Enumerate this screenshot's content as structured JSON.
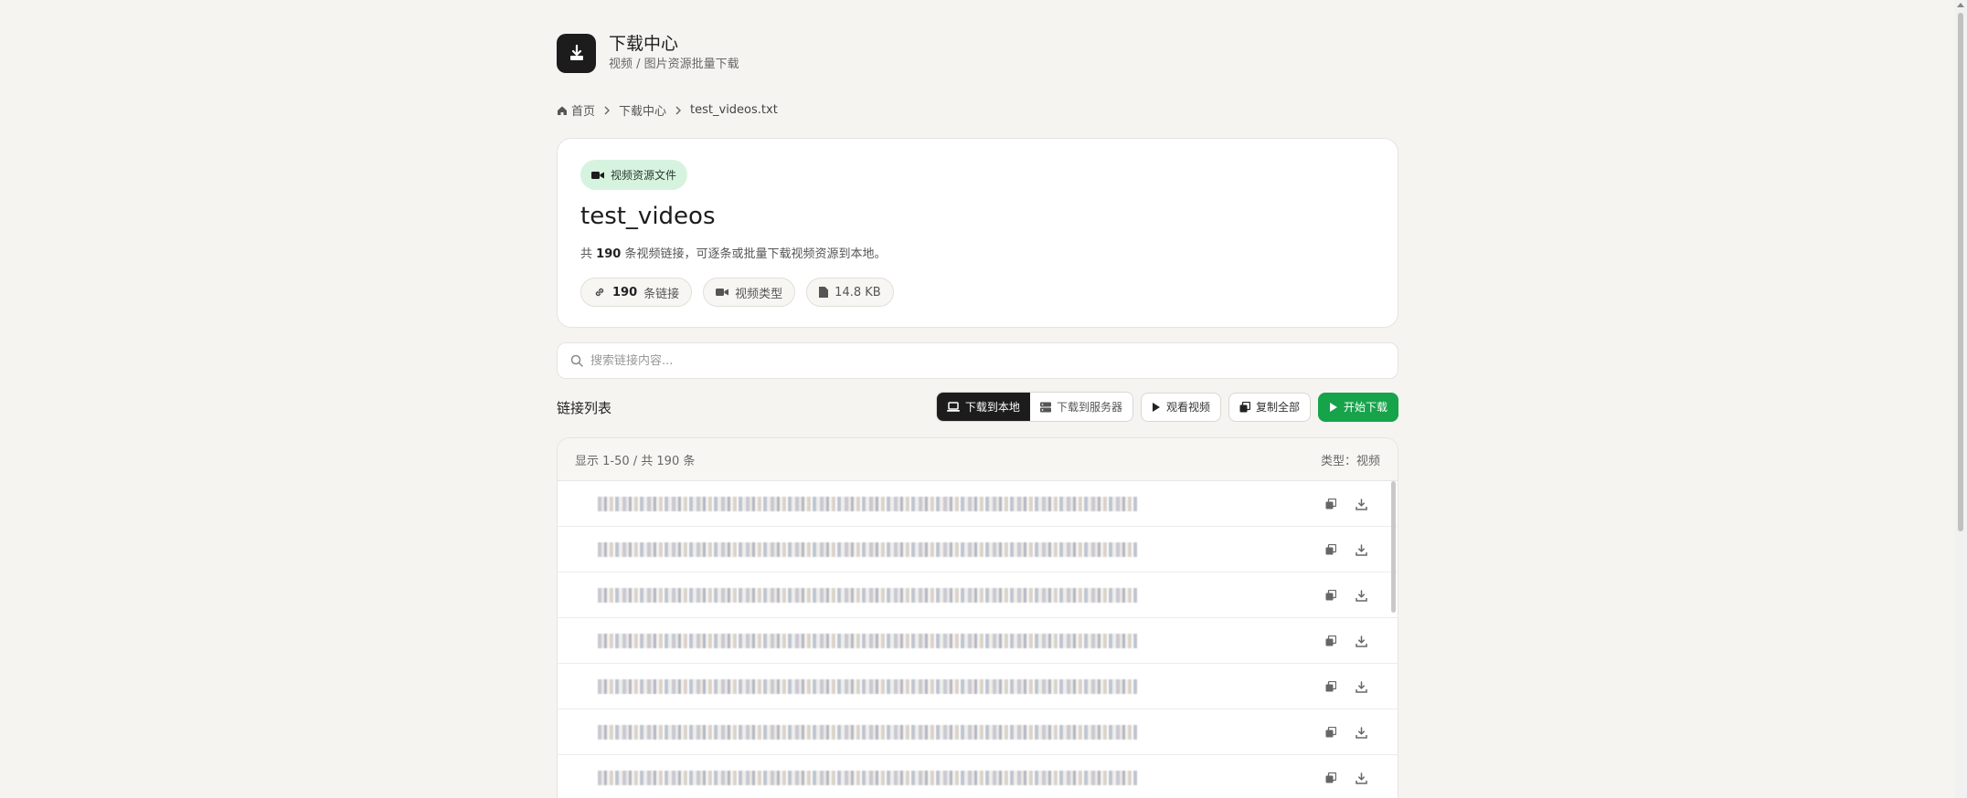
{
  "app": {
    "title": "下载中心",
    "subtitle": "视频 / 图片资源批量下载",
    "logo_icon": "download-icon"
  },
  "breadcrumb": {
    "home": "首页",
    "section": "下载中心",
    "current": "test_videos.txt"
  },
  "file": {
    "badge": "视频资源文件",
    "title": "test_videos",
    "desc_prefix": "共",
    "desc_count": "190",
    "desc_suffix": "条视频链接，可逐条或批量下载视频资源到本地。",
    "chips": {
      "links_count": "190",
      "links_label": "条链接",
      "type_label": "视频类型",
      "size": "14.8 KB"
    }
  },
  "search": {
    "placeholder": "搜索链接内容..."
  },
  "list": {
    "title": "链接列表",
    "range": "显示 1-50 / 共 190 条",
    "type": "类型：视频",
    "rows": [
      "",
      "",
      "",
      "",
      "",
      "",
      ""
    ]
  },
  "toolbar": {
    "download_local": "下载到本地",
    "download_server": "下载到服务器",
    "watch_video": "观看视频",
    "copy_all": "复制全部",
    "start_download": "开始下载"
  },
  "colors": {
    "primary": "#16a34a",
    "dark": "#1c1c1c",
    "badge_bg": "#d6f3df",
    "page_bg": "#f5f4f1"
  }
}
